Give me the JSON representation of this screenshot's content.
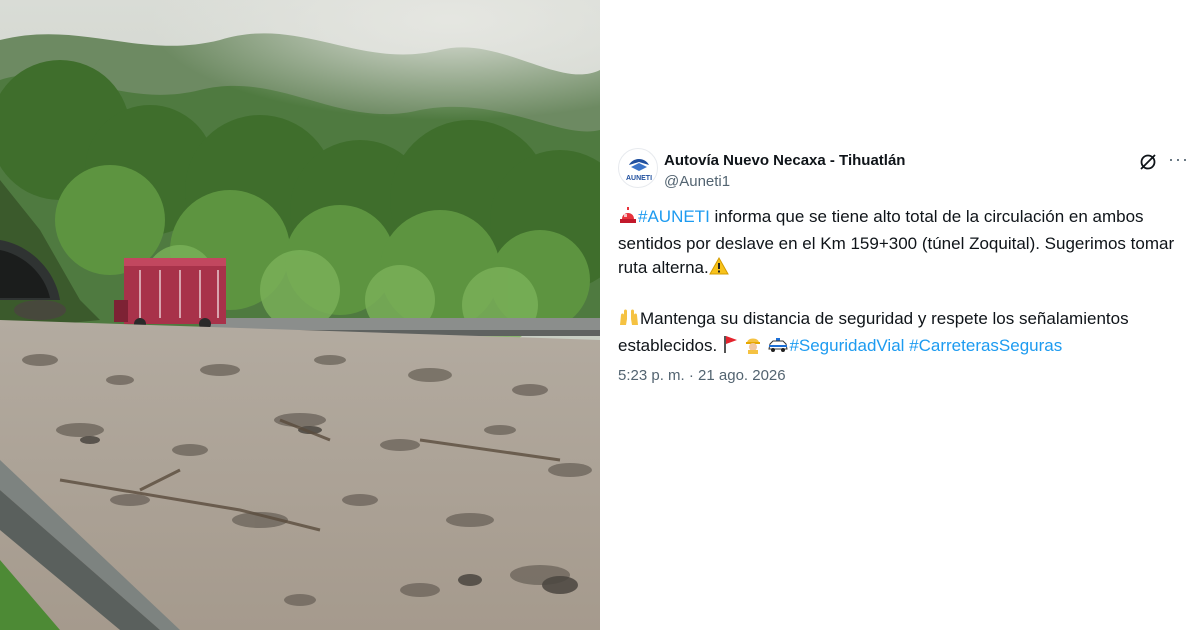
{
  "tweet": {
    "author": {
      "display_name": "Autovía Nuevo Necaxa - Tihuatlán",
      "handle": "@Auneti1",
      "avatar_label": "AUNETI"
    },
    "line1": {
      "hashtag": "#AUNETI",
      "text": " informa que se tiene alto total de la circulación en ambos sentidos por deslave en el Km 159+300 (túnel Zoquital). Sugerimos tomar ruta alterna."
    },
    "line2": {
      "text": "Mantenga su distancia de seguridad y respete los señalamientos establecidos.",
      "hashtags": [
        "#SeguridadVial",
        "#CarreterasSeguras"
      ]
    },
    "timestamp": "5:23 p. m. · 21 ago. 2026",
    "icons": [
      "siren-emoji",
      "warning-emoji",
      "raised-hands-emoji",
      "red-flag-emoji",
      "construction-worker-emoji",
      "police-car-emoji",
      "grok-icon",
      "more-icon"
    ],
    "colors": {
      "link": "#1d9bf0",
      "text": "#0f1419",
      "muted": "#536471"
    }
  }
}
